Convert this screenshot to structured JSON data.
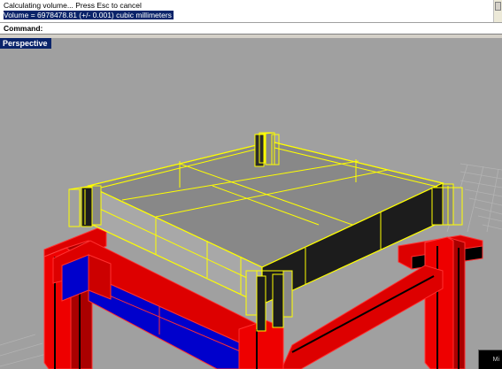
{
  "command_history": {
    "lines": [
      "Calculating volume... Press Esc to cancel",
      "Volume = 6978478.81 (+/- 0.001) cubic millimeters"
    ]
  },
  "command_prompt": {
    "label": "Command:",
    "value": ""
  },
  "viewport": {
    "title": "Perspective",
    "background_color": "#a0a0a0",
    "grid_color": "#b0b0b0",
    "selection_color": "#ffff00",
    "frame_color": "#ff0000",
    "beam_fill_color": "#0000cc"
  },
  "corner_tab": {
    "label": "Mi"
  }
}
